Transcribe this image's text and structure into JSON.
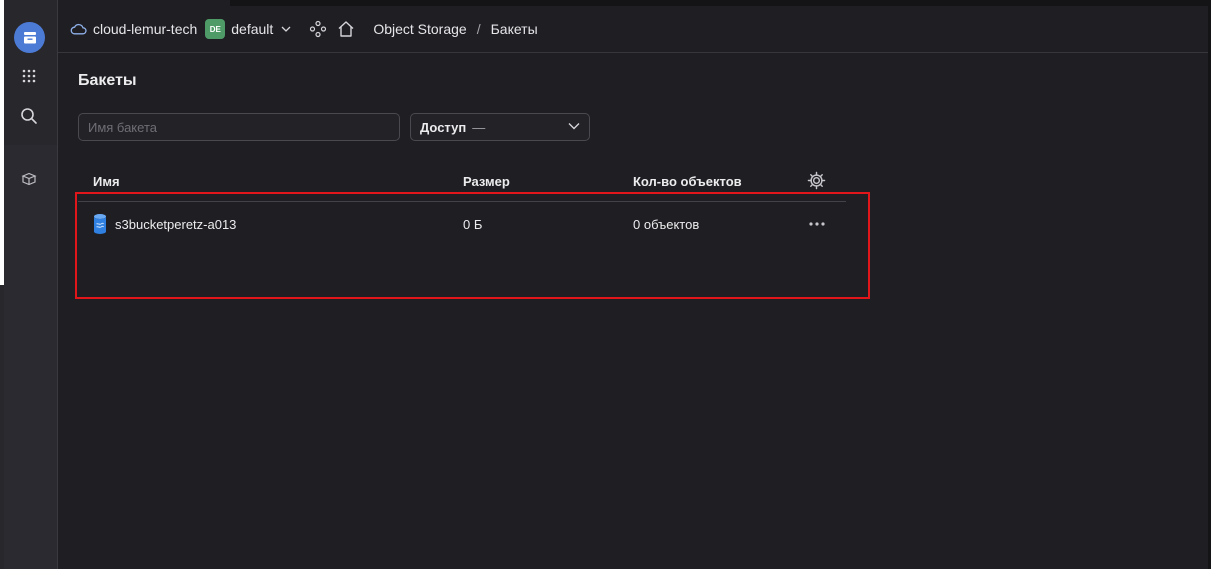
{
  "header": {
    "cloud_name": "cloud-lemur-tech",
    "folder_badge": "DE",
    "folder_name": "default",
    "breadcrumb": {
      "service": "Object Storage",
      "separator": "/",
      "current": "Бакеты"
    }
  },
  "sidebar": {
    "items": [
      "services-menu",
      "search",
      "marketplace"
    ]
  },
  "page": {
    "title": "Бакеты"
  },
  "filters": {
    "search_placeholder": "Имя бакета",
    "access_label": "Доступ",
    "access_value": "—"
  },
  "table": {
    "columns": [
      "Имя",
      "Размер",
      "Кол-во объектов"
    ],
    "rows": [
      {
        "name": "s3bucketperetz-a013",
        "size": "0 Б",
        "objects": "0 объектов"
      }
    ]
  },
  "colors": {
    "background": "#1f1e22",
    "sidebar": "#28272c",
    "accent": "#4c7bd6",
    "folder_badge": "#4f9b68",
    "highlight": "#e0161b",
    "bucket_icon": "#2f80e0"
  }
}
